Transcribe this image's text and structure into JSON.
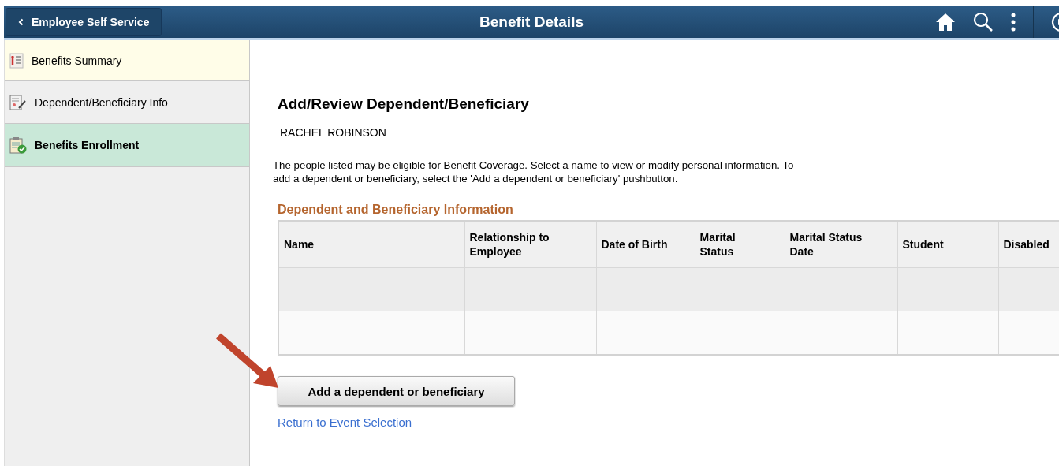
{
  "header": {
    "back_button": "Employee Self Service",
    "title": "Benefit Details"
  },
  "sidebar": {
    "items": [
      {
        "label": "Benefits Summary",
        "selected": false,
        "highlighted": true
      },
      {
        "label": "Dependent/Beneficiary Info",
        "selected": false,
        "highlighted": false
      },
      {
        "label": "Benefits Enrollment",
        "selected": true,
        "highlighted": false
      }
    ]
  },
  "content": {
    "heading": "Add/Review Dependent/Beneficiary",
    "employee_name": "RACHEL ROBINSON",
    "instructions": "The people listed may be eligible for Benefit Coverage. Select a name to view or modify personal information. To add a dependent or beneficiary, select the 'Add a dependent or beneficiary' pushbutton.",
    "table": {
      "title": "Dependent and Beneficiary Information",
      "columns": [
        "Name",
        "Relationship to Employee",
        "Date of Birth",
        "Marital Status",
        "Marital Status Date",
        "Student",
        "Disabled"
      ]
    },
    "add_button": "Add a dependent or beneficiary",
    "return_link": "Return to Event Selection"
  }
}
